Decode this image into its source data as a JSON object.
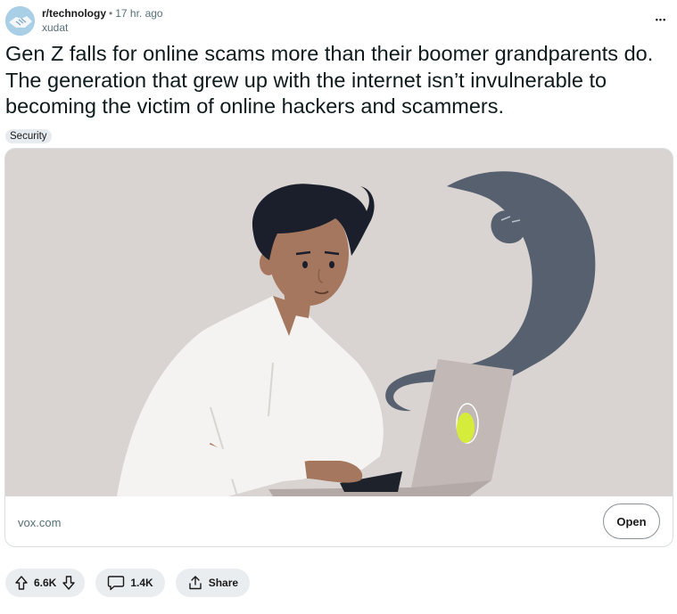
{
  "post": {
    "subreddit": "r/technology",
    "separator": "•",
    "time": "17 hr. ago",
    "author": "xudat",
    "more_label": "•••",
    "title": "Gen Z falls for online scams more than their boomer grandparents do. The generation that grew up with the internet isn’t invulnerable to becoming the victim of online hackers and scammers.",
    "flair": "Security"
  },
  "link_card": {
    "domain": "vox.com",
    "open_label": "Open"
  },
  "actions": {
    "upvotes": "6.6K",
    "comments": "1.4K",
    "share_label": "Share"
  },
  "icons": {
    "avatar": "handshake-avatar-icon",
    "upvote": "arrow-up-icon",
    "downvote": "arrow-down-icon",
    "comment": "speech-bubble-icon",
    "share": "share-icon",
    "more": "ellipsis-icon"
  },
  "colors": {
    "flair_bg": "#e5ebee",
    "action_bg": "#eaedef",
    "image_bg": "#d9d3d1",
    "ghost": "#56606e",
    "sticker": "#d6ec3a"
  }
}
